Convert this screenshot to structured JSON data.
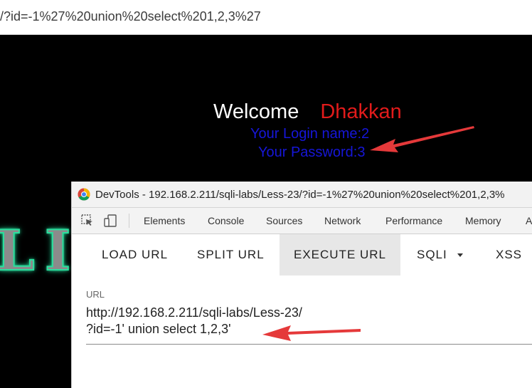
{
  "browser": {
    "url_fragment": "/?id=-1%27%20union%20select%201,2,3%27"
  },
  "page": {
    "welcome": "Welcome",
    "username_display": "Dhakkan",
    "login_line": "Your Login name:2",
    "password_line": "Your Password:3",
    "logo_text": "LI I"
  },
  "devtools": {
    "title": "DevTools - 192.168.2.211/sqli-labs/Less-23/?id=-1%27%20union%20select%201,2,3%",
    "tabs": [
      "Elements",
      "Console",
      "Sources",
      "Network",
      "Performance",
      "Memory",
      "A"
    ]
  },
  "hackbar": {
    "buttons": [
      "LOAD URL",
      "SPLIT URL",
      "EXECUTE URL",
      "SQLI",
      "XSS"
    ],
    "url_label": "URL",
    "url_line1": "http://192.168.2.211/sqli-labs/Less-23/",
    "url_line2": "?id=-1' union select 1,2,3'"
  },
  "colors": {
    "arrow": "#e5393a",
    "welcome_name": "#e21b1b",
    "result_text": "#1616d8"
  }
}
